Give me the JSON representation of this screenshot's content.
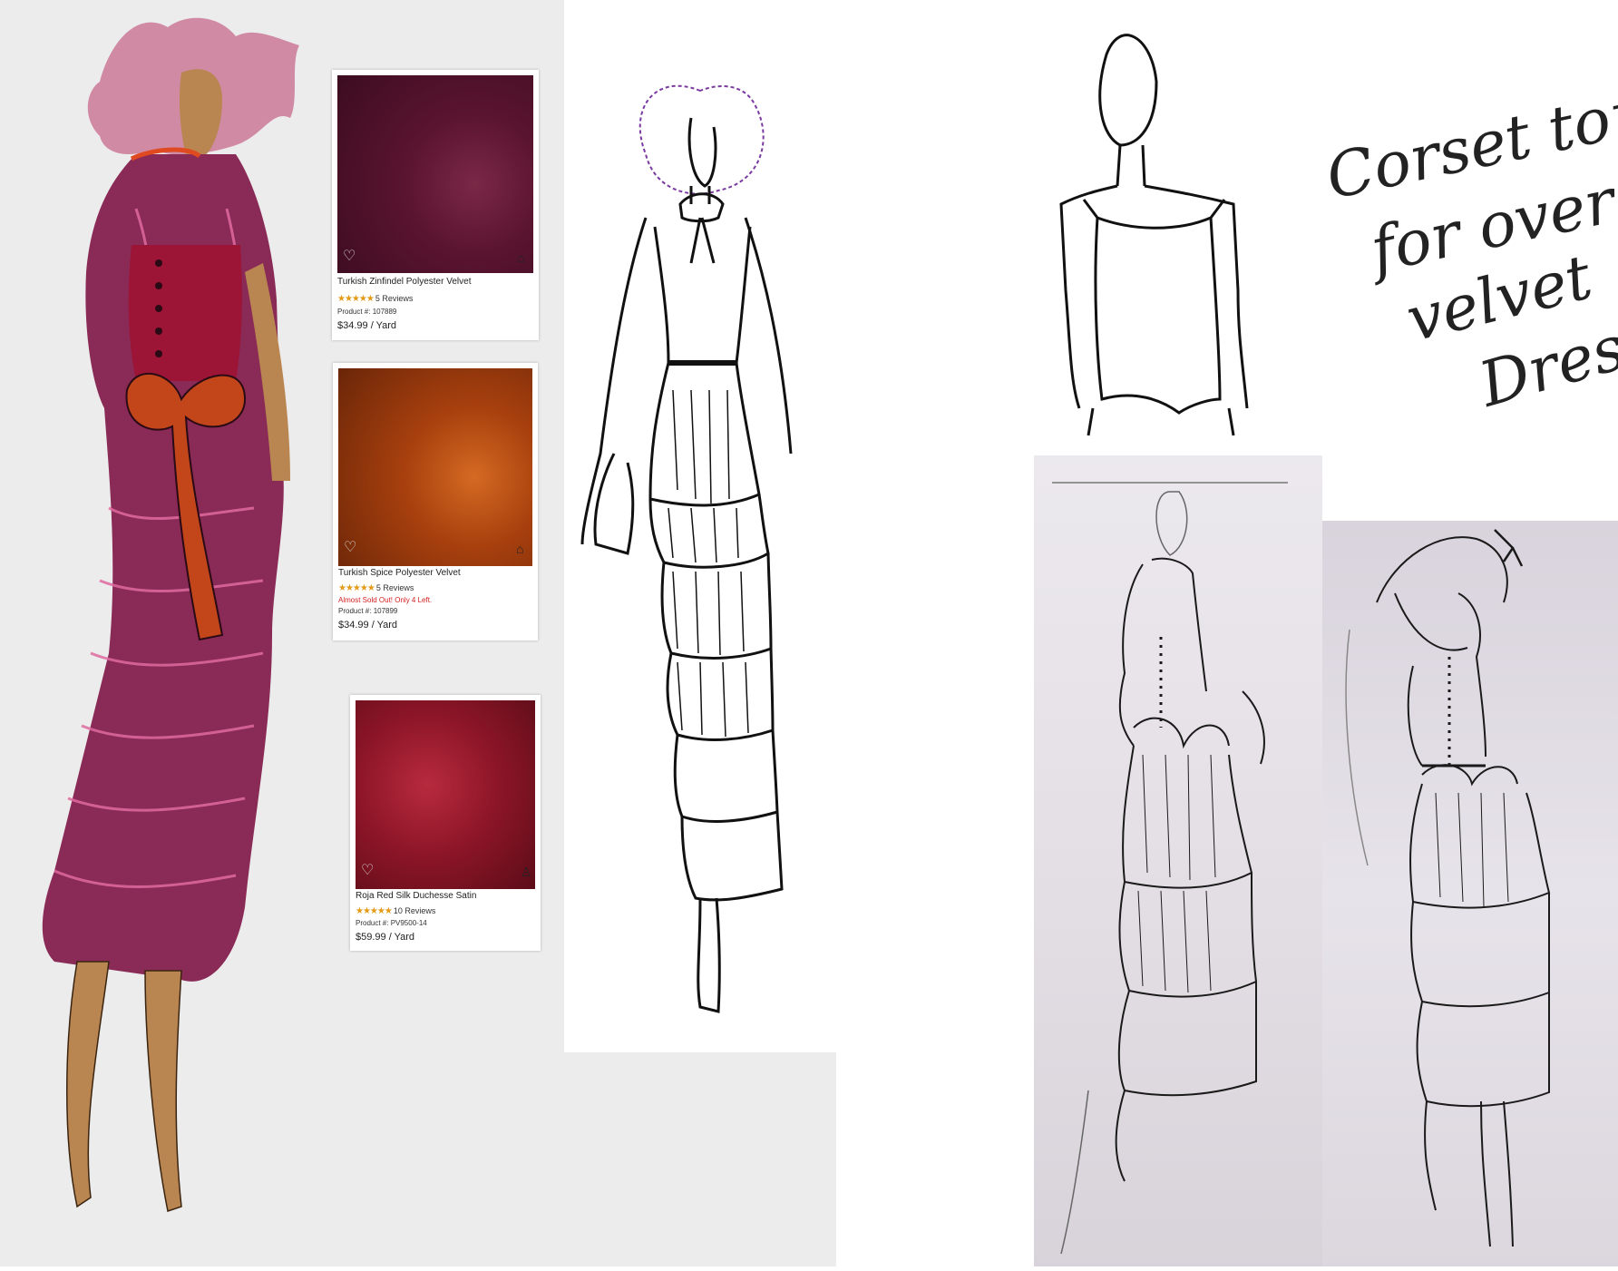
{
  "swatches": [
    {
      "title": "Turkish Zinfindel Polyester Velvet",
      "stars": "★★★★★",
      "reviews": "5 Reviews",
      "note": "",
      "product": "Product #: 107889",
      "price": "$34.99 / Yard",
      "color": "#5a1430",
      "icon": "home-icon"
    },
    {
      "title": "Turkish Spice Polyester Velvet",
      "stars": "★★★★★",
      "reviews": "5 Reviews",
      "note": "Almost Sold Out! Only 4 Left.",
      "product": "Product #: 107899",
      "price": "$34.99 / Yard",
      "color": "#a8400e",
      "icon": "home-icon"
    },
    {
      "title": "Roja Red Silk Duchesse Satin",
      "stars": "★★★★★",
      "reviews": "10 Reviews",
      "note": "",
      "product": "Product #: PV9500-14",
      "price": "$59.99 / Yard",
      "color": "#8e1628",
      "icon": "dress-form-icon"
    }
  ],
  "handwritten_note": {
    "line1": "Corset top",
    "line2": "for over",
    "line3": "velvet",
    "line4": "Dress"
  },
  "colors": {
    "dress": "#8a2a56",
    "dress_highlight": "#e06aa0",
    "corset": "#9c1436",
    "bow": "#c2461a",
    "hair": "#d08aa4",
    "skin": "#b98652"
  }
}
